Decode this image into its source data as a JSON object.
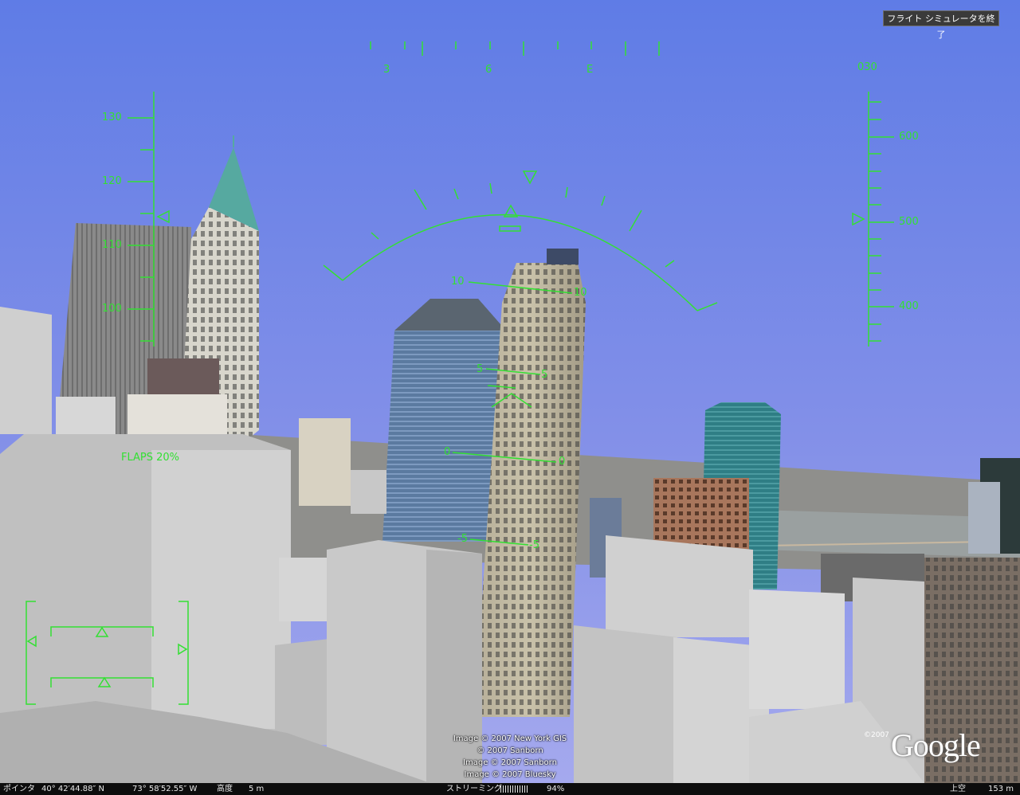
{
  "exit_button": "フライト シミュレータを終了",
  "hud": {
    "heading_labels": [
      "3",
      "6",
      "E"
    ],
    "heading_value": "030",
    "speed_labels": [
      "130",
      "120",
      "110",
      "100"
    ],
    "altitude_labels": [
      "600",
      "500",
      "400"
    ],
    "pitch_labels": [
      "10",
      "10",
      "5",
      "5",
      "0",
      "0",
      "-5",
      "-5"
    ],
    "flaps": "FLAPS 20%",
    "color": "#33e033"
  },
  "attribution": [
    "Image © 2007 New York GIS",
    "© 2007 Sanborn",
    "Image © 2007 Sanborn",
    "Image © 2007 Bluesky"
  ],
  "logo": {
    "copyright": "©2007",
    "text": "Google"
  },
  "statusbar": {
    "pointer_label": "ポインタ",
    "lat": "40° 42′44.88″ N",
    "lon": "73° 58′52.55″ W",
    "elev_label": "高度",
    "elev_value": "5 m",
    "streaming_label": "ストリーミング",
    "streaming_value": "94%",
    "eye_label": "上空",
    "eye_value": "153 m"
  }
}
